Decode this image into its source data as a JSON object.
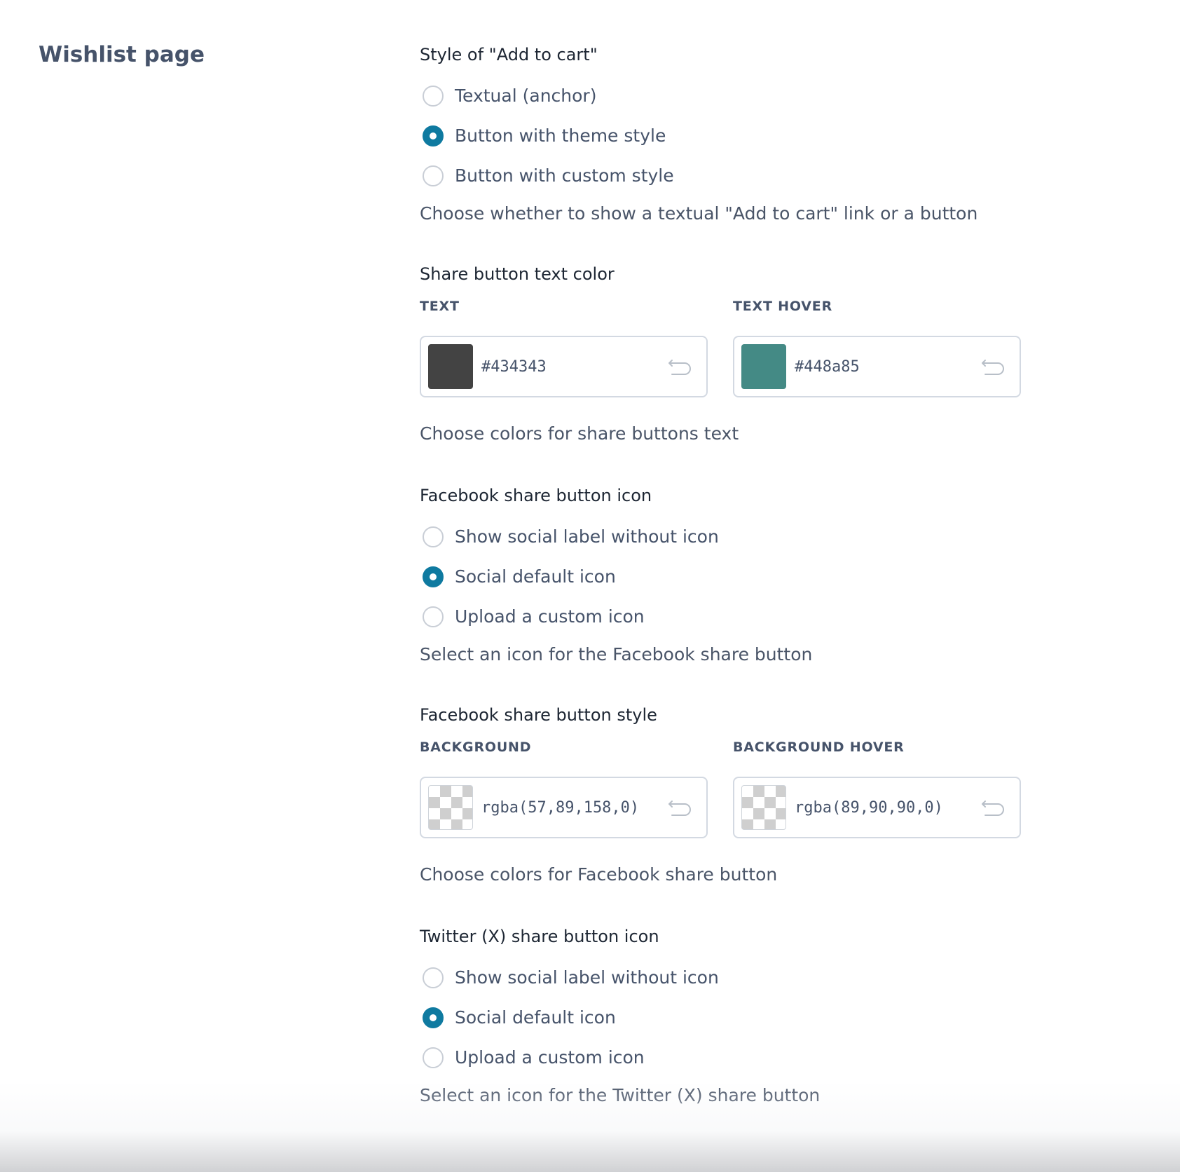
{
  "section": {
    "title": "Wishlist page"
  },
  "add_to_cart_style": {
    "label": "Style of \"Add to cart\"",
    "options": [
      {
        "label": "Textual (anchor)",
        "checked": false
      },
      {
        "label": "Button with theme style",
        "checked": true
      },
      {
        "label": "Button with custom style",
        "checked": false
      }
    ],
    "description": "Choose whether to show a textual \"Add to cart\" link or a button"
  },
  "share_text_color": {
    "label": "Share button text color",
    "text": {
      "label": "TEXT",
      "value": "#434343",
      "swatch": "#434343"
    },
    "text_hover": {
      "label": "TEXT HOVER",
      "value": "#448a85",
      "swatch": "#448a85"
    },
    "description": "Choose colors for share buttons text"
  },
  "facebook_icon": {
    "label": "Facebook share button icon",
    "options": [
      {
        "label": "Show social label without icon",
        "checked": false
      },
      {
        "label": "Social default icon",
        "checked": true
      },
      {
        "label": "Upload a custom icon",
        "checked": false
      }
    ],
    "description": "Select an icon for the Facebook share button"
  },
  "facebook_style": {
    "label": "Facebook share button style",
    "background": {
      "label": "BACKGROUND",
      "value": "rgba(57,89,158,0)"
    },
    "background_hover": {
      "label": "BACKGROUND HOVER",
      "value": "rgba(89,90,90,0)"
    },
    "description": "Choose colors for Facebook share button"
  },
  "twitter_icon": {
    "label": "Twitter (X) share button icon",
    "options": [
      {
        "label": "Show social label without icon",
        "checked": false
      },
      {
        "label": "Social default icon",
        "checked": true
      },
      {
        "label": "Upload a custom icon",
        "checked": false
      }
    ],
    "description": "Select an icon for the Twitter (X) share button"
  },
  "icons": {
    "reset": "reset-undo-icon"
  },
  "colors": {
    "accent": "#0f7aa0",
    "text": "#46536a",
    "heading": "#1d2633",
    "border": "#d3d9e2"
  }
}
